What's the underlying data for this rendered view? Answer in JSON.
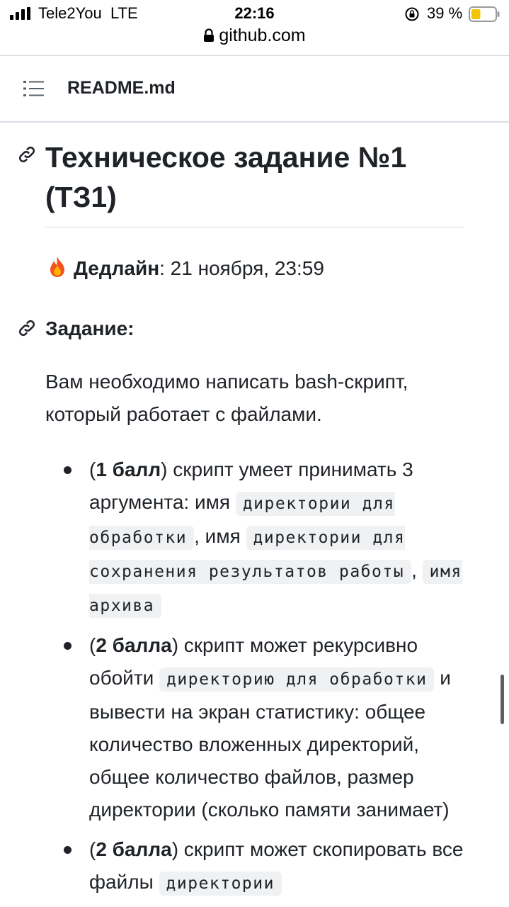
{
  "status_bar": {
    "carrier": "Tele2You",
    "network": "LTE",
    "time": "22:16",
    "battery_percent": "39 %",
    "battery_level": 0.39,
    "battery_color": "#f2c500"
  },
  "url_bar": {
    "domain": "github.com"
  },
  "file_header": {
    "filename": "README.md"
  },
  "readme": {
    "title": "Техническое задание №1 (ТЗ1)",
    "deadline": {
      "label": "Дедлайн",
      "value": ": 21 ноября, 23:59"
    },
    "task_heading": "Задание:",
    "intro": "Вам необходимо написать bash-скрипт, который работает с файлами.",
    "items": [
      {
        "score": "1 балл",
        "t1": ") скрипт умеет принимать 3 аргумента: имя ",
        "c1": "директории для обработки",
        "t2": ", имя ",
        "c2": "директории для сохранения результатов работы",
        "t3": ", ",
        "c3": "имя архива"
      },
      {
        "score": "2 балла",
        "t1": ") скрипт может рекурсивно обойти ",
        "c1": "директорию для обработки",
        "t2": " и вывести на экран статистику: общее количество вложенных директорий, общее количество файлов, размер директории (сколько памяти занимает)"
      },
      {
        "score": "2 балла",
        "t1": ") скрипт может скопировать все файлы ",
        "c1": "директории"
      }
    ]
  },
  "icons": {
    "signal": "signal-bars-icon",
    "rotation_lock": "rotation-lock-icon",
    "battery": "battery-icon",
    "secure": "lock-icon",
    "menu": "list-icon",
    "anchor": "link-icon",
    "deadline": "fire-icon"
  }
}
